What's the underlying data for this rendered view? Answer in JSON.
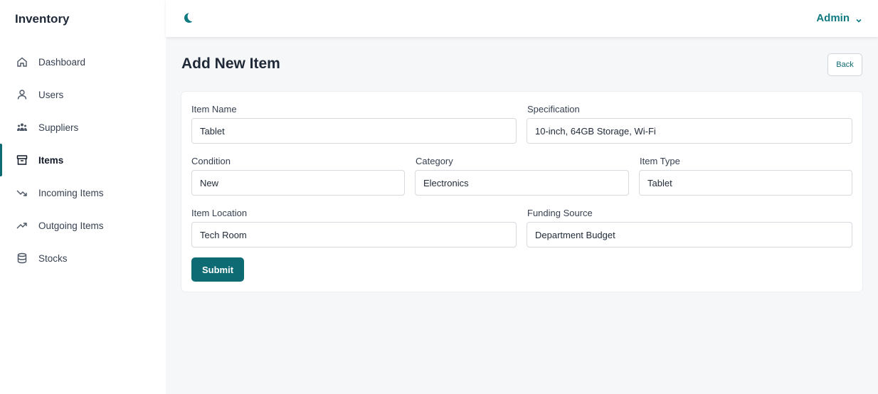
{
  "sidebar": {
    "brand": "Inventory",
    "items": [
      {
        "label": "Dashboard",
        "icon": "home-icon"
      },
      {
        "label": "Users",
        "icon": "user-icon"
      },
      {
        "label": "Suppliers",
        "icon": "users-group-icon"
      },
      {
        "label": "Items",
        "icon": "archive-box-icon",
        "active": true
      },
      {
        "label": "Incoming Items",
        "icon": "trend-down-icon"
      },
      {
        "label": "Outgoing Items",
        "icon": "trend-up-icon"
      },
      {
        "label": "Stocks",
        "icon": "database-icon"
      }
    ]
  },
  "topbar": {
    "theme_icon": "moon-icon",
    "user_label": "Admin"
  },
  "page": {
    "title": "Add New Item",
    "back_label": "Back"
  },
  "form": {
    "item_name": {
      "label": "Item Name",
      "value": "Tablet"
    },
    "specification": {
      "label": "Specification",
      "value": "10-inch, 64GB Storage, Wi-Fi"
    },
    "condition": {
      "label": "Condition",
      "value": "New"
    },
    "category": {
      "label": "Category",
      "value": "Electronics"
    },
    "item_type": {
      "label": "Item Type",
      "value": "Tablet"
    },
    "item_location": {
      "label": "Item Location",
      "value": "Tech Room"
    },
    "funding_source": {
      "label": "Funding Source",
      "value": "Department Budget"
    },
    "submit_label": "Submit"
  },
  "colors": {
    "accent": "#0f6b73",
    "accent_text": "#0f7a80",
    "background": "#f6f7f9"
  }
}
